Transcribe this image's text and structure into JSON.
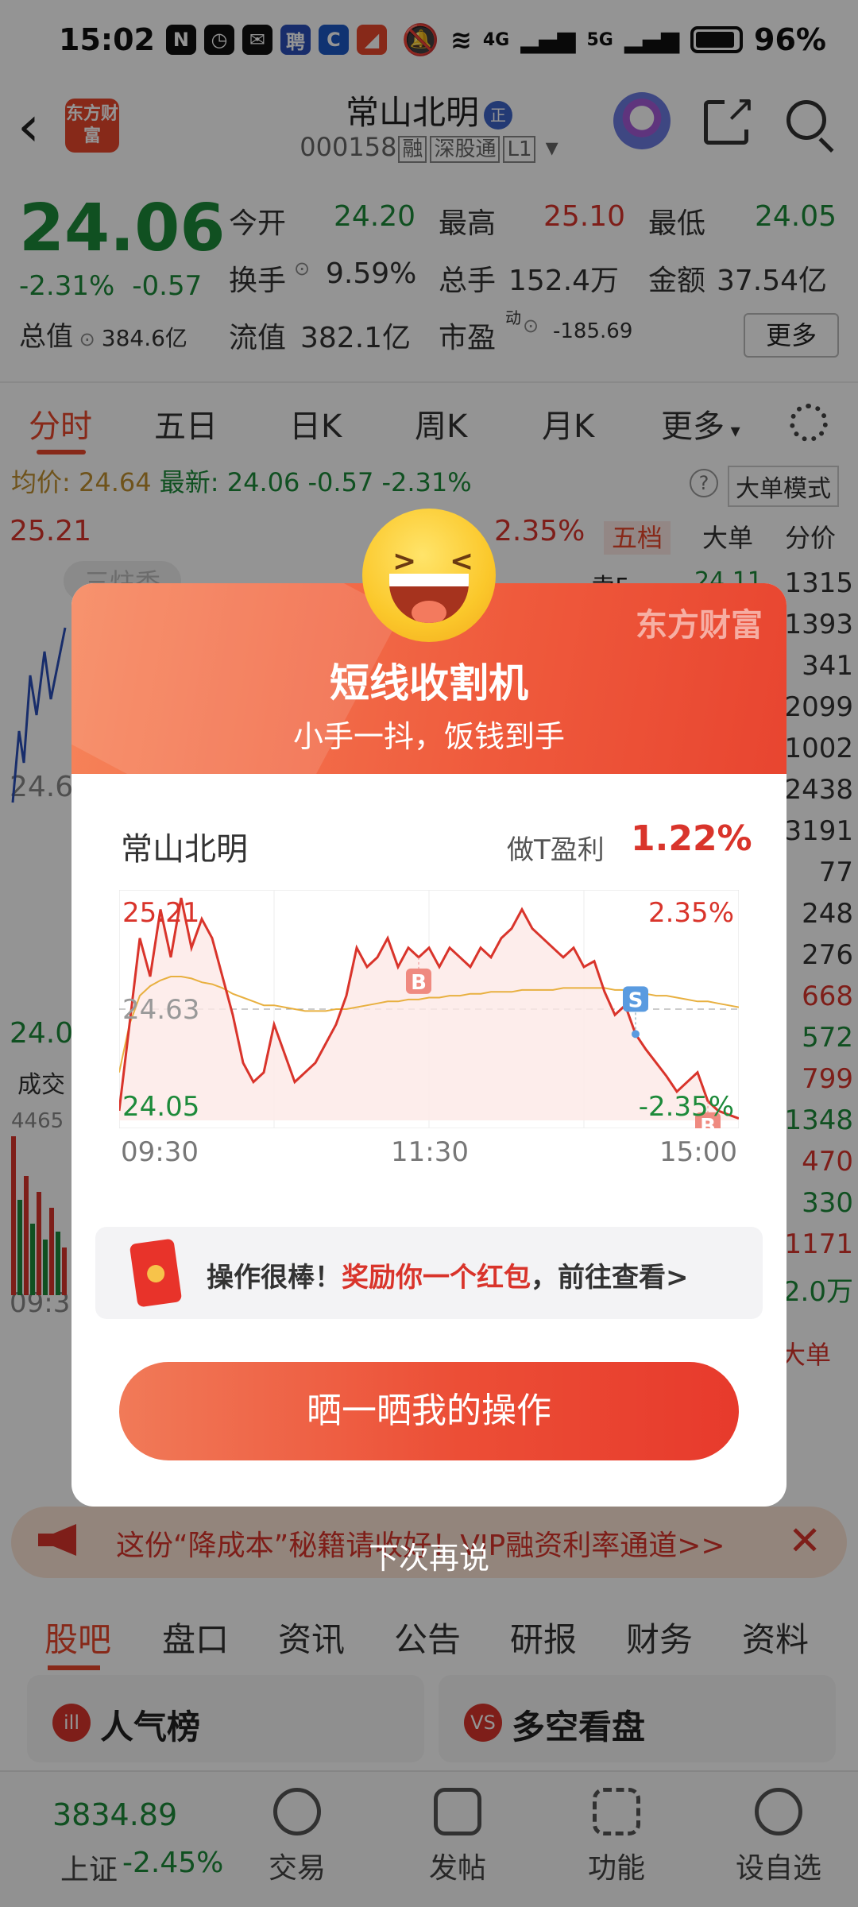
{
  "status_bar": {
    "time": "15:02",
    "battery": "96%",
    "signal_4g": "4G",
    "signal_5g": "5G"
  },
  "header": {
    "logo": "东方财富",
    "name": "常山北明",
    "name_badge": "正",
    "code": "000158",
    "tags": [
      "融",
      "深股通",
      "L1"
    ]
  },
  "quote": {
    "price": "24.06",
    "chg_pct": "-2.31%",
    "chg": "-0.57",
    "open_label": "今开",
    "open": "24.20",
    "high_label": "最高",
    "high": "25.10",
    "low_label": "最低",
    "low": "24.05",
    "turnover_label": "换手",
    "turnover": "9.59%",
    "volume_label": "总手",
    "volume": "152.4万",
    "amount_label": "金额",
    "amount": "37.54亿",
    "mcap_label": "总值",
    "mcap": "384.6亿",
    "float_label": "流值",
    "float": "382.1亿",
    "pe_label": "市盈",
    "pe_sup": "动",
    "pe": "-185.69",
    "more": "更多"
  },
  "chart_tabs": [
    "分时",
    "五日",
    "日K",
    "周K",
    "月K",
    "更多"
  ],
  "avg_line": {
    "avg_label": "均价:",
    "avg": "24.64",
    "latest_label": "最新:",
    "latest": "24.06",
    "chg": "-0.57",
    "pct": "-2.31%",
    "mode": "大单模式"
  },
  "bg_chart": {
    "top_price": "25.21",
    "top_pct": "2.35%",
    "mid_price": "24.6",
    "bot_price": "24.0",
    "vol_label": "成交",
    "vol_val": "4465",
    "time": "09:3",
    "watermark": "三炷香"
  },
  "orderbook": {
    "tabs": [
      "五档",
      "大单",
      "分价"
    ],
    "first_row_label": "卖5",
    "first_row_price": "24.11",
    "rows": [
      "1315",
      "1393",
      "341",
      "2099",
      "1002",
      "2438",
      "3191",
      "77",
      "248",
      "276",
      "668",
      "572",
      "799",
      "1348",
      "470",
      "330",
      "1171",
      "2.0万"
    ],
    "footer": "大单"
  },
  "promo": {
    "text": "这份“降成本”秘籍请收好！VIP融资利率通道>>"
  },
  "bottom_tabs": [
    "股吧",
    "盘口",
    "资讯",
    "公告",
    "研报",
    "财务",
    "资料"
  ],
  "cards": [
    {
      "icon": "ill",
      "label": "人气榜"
    },
    {
      "icon": "VS",
      "label": "多空看盘"
    }
  ],
  "navbar": {
    "index_val": "3834.89",
    "index_name": "上证",
    "index_chg": "-2.45%",
    "items": [
      "交易",
      "发帖",
      "功能",
      "设自选"
    ]
  },
  "modal": {
    "brand": "东方财富",
    "title": "短线收割机",
    "subtitle": "小手一抖，饭钱到手",
    "stock": "常山北明",
    "profit_label": "做T盈利",
    "profit": "1.22%",
    "buy_marker": "B",
    "sell_marker": "S",
    "redpack_prefix": "操作很棒！",
    "redpack_highlight": "奖励你一个红包",
    "redpack_suffix": "，前往查看>",
    "button": "晒一晒我的操作",
    "later": "下次再说"
  },
  "colors": {
    "accent": "#e8472c",
    "up": "#d9342b",
    "down": "#1d8a3a",
    "avg_line": "#e8b040"
  },
  "chart_data": {
    "type": "line",
    "x_ticks": [
      "09:30",
      "11:30",
      "15:00"
    ],
    "ylim": [
      24.05,
      25.21
    ],
    "y_tick_labels": {
      "top": "25.21",
      "mid": "24.63",
      "bottom": "24.05"
    },
    "pct_labels": {
      "top": "2.35%",
      "bottom": "-2.35%"
    },
    "x": [
      "09:30",
      "09:34",
      "09:38",
      "09:42",
      "09:46",
      "09:50",
      "09:54",
      "09:58",
      "10:02",
      "10:06",
      "10:10",
      "10:14",
      "10:18",
      "10:22",
      "10:26",
      "10:30",
      "10:34",
      "10:38",
      "10:42",
      "10:46",
      "10:50",
      "10:54",
      "10:58",
      "11:02",
      "11:06",
      "11:10",
      "11:14",
      "11:18",
      "11:22",
      "11:26",
      "11:30",
      "13:04",
      "13:08",
      "13:12",
      "13:16",
      "13:20",
      "13:24",
      "13:28",
      "13:32",
      "13:36",
      "13:40",
      "13:44",
      "13:48",
      "13:52",
      "13:56",
      "14:00",
      "14:04",
      "14:08",
      "14:12",
      "14:16",
      "14:20",
      "14:24",
      "14:28",
      "14:32",
      "14:36",
      "14:40",
      "14:44",
      "14:48",
      "14:52",
      "14:56",
      "15:00"
    ],
    "series": [
      {
        "values": [
          24.1,
          24.55,
          25.0,
          24.8,
          25.15,
          24.9,
          25.21,
          24.95,
          25.1,
          25.0,
          24.8,
          24.6,
          24.35,
          24.25,
          24.3,
          24.55,
          24.4,
          24.25,
          24.3,
          24.35,
          24.45,
          24.55,
          24.7,
          24.95,
          24.85,
          24.9,
          25.0,
          24.85,
          24.95,
          24.9,
          24.95,
          24.85,
          24.95,
          24.9,
          24.85,
          24.95,
          24.9,
          25.0,
          25.05,
          25.15,
          25.05,
          25.0,
          24.95,
          24.9,
          24.95,
          24.85,
          24.88,
          24.72,
          24.6,
          24.65,
          24.5,
          24.42,
          24.35,
          24.28,
          24.2,
          24.25,
          24.3,
          24.15,
          24.1,
          24.08,
          24.06
        ]
      },
      {
        "values": [
          24.3,
          24.55,
          24.7,
          24.75,
          24.78,
          24.8,
          24.8,
          24.79,
          24.77,
          24.76,
          24.74,
          24.71,
          24.69,
          24.67,
          24.65,
          24.65,
          24.64,
          24.63,
          24.62,
          24.62,
          24.62,
          24.63,
          24.63,
          24.64,
          24.65,
          24.66,
          24.67,
          24.67,
          24.68,
          24.68,
          24.69,
          24.69,
          24.7,
          24.7,
          24.71,
          24.71,
          24.72,
          24.72,
          24.72,
          24.73,
          24.73,
          24.73,
          24.73,
          24.74,
          24.74,
          24.74,
          24.74,
          24.74,
          24.73,
          24.73,
          24.72,
          24.71,
          24.7,
          24.7,
          24.69,
          24.68,
          24.67,
          24.67,
          24.66,
          24.65,
          24.64
        ]
      }
    ],
    "markers": [
      {
        "label": "B",
        "x": "11:26"
      },
      {
        "label": "S",
        "x": "14:20"
      },
      {
        "label": "B",
        "x": "14:48"
      }
    ]
  }
}
